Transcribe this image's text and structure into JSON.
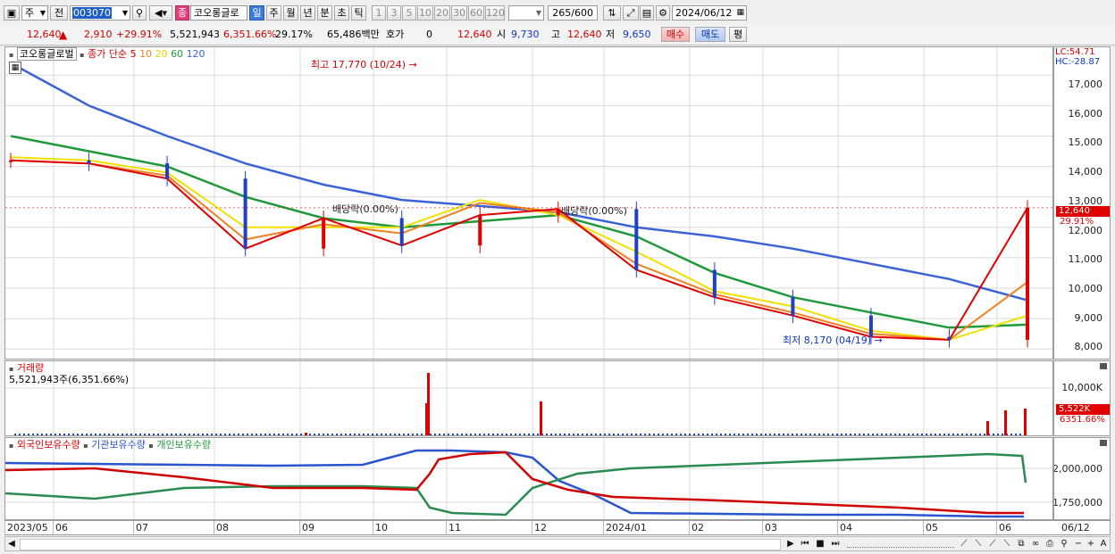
{
  "toolbar": {
    "period_opt": "주",
    "prev_label": "전",
    "code": "003070",
    "name_badge": "종",
    "name": "코오롱글로",
    "periods": [
      "일",
      "주",
      "월",
      "년",
      "분",
      "초",
      "틱"
    ],
    "selected_period": "일",
    "minutes": [
      "1",
      "3",
      "5",
      "10",
      "20",
      "30",
      "60",
      "120"
    ],
    "count": "265",
    "count_max": "/600",
    "date": "2024/06/12"
  },
  "quote": {
    "price": "12,640",
    "change": "2,910",
    "change_pct": "+29.91%",
    "volume": "5,521,943",
    "volume_pct": "6,351.66%",
    "turnover_pct": "29.17%",
    "amount": "65,486백만",
    "hoga_label": "호가",
    "hoga": "0",
    "hoga_price": "12,640",
    "open_label": "시",
    "open": "9,730",
    "high_label": "고",
    "high": "12,640",
    "low_label": "저",
    "low": "9,650",
    "buy_btn": "매수",
    "sell_btn": "매도",
    "eval_btn": "평"
  },
  "price_panel": {
    "legend_name": "코오롱글로벌",
    "legend_ma": "종가 단순",
    "ma_periods": [
      "5",
      "10",
      "20",
      "60",
      "120"
    ],
    "lc": "LC:54.71",
    "hc": "HC:-28.87",
    "hi_annot": "최고 17,770 (10/24)",
    "lo_annot": "최저 8,170 (04/19)",
    "div1": "배당락(0.00%)",
    "div2": "배당락(0.00%)",
    "last_price": "12,640",
    "last_pct": "29.91%",
    "y_ticks": [
      "17,000",
      "16,000",
      "15,000",
      "14,000",
      "13,000",
      "12,000",
      "11,000",
      "10,000",
      "9,000",
      "8,000"
    ]
  },
  "volume_panel": {
    "title": "거래량",
    "value": "5,521,943주(6,351.66%)",
    "y_tick": "10,000K",
    "last": "5,522K",
    "last_pct": "6351.66%"
  },
  "holder_panel": {
    "foreign": "외국인보유수량",
    "inst": "기관보유수량",
    "indiv": "개인보유수량",
    "y_ticks": [
      "2,000,000",
      "1,750,000"
    ]
  },
  "x_axis": [
    "2023/05",
    "06",
    "07",
    "08",
    "09",
    "10",
    "11",
    "12",
    "2024/01",
    "02",
    "03",
    "04",
    "05",
    "06",
    "06/12"
  ],
  "colors": {
    "up": "#e00000",
    "down": "#1f3fc9",
    "ma5": "#e00000",
    "ma10": "#f08020",
    "ma20": "#f2e000",
    "ma60": "#1f9a3a",
    "ma120": "#3b63d8"
  },
  "chart_data": {
    "type": "line",
    "x": [
      "2023/05",
      "2023/06",
      "2023/07",
      "2023/08",
      "2023/09",
      "2023/10",
      "2023/11",
      "2023/12",
      "2024/01",
      "2024/02",
      "2024/03",
      "2024/04",
      "2024/05",
      "2024/06"
    ],
    "series": [
      {
        "name": "5",
        "values": [
          14200,
          14100,
          13600,
          11300,
          12300,
          11400,
          12400,
          12600,
          10600,
          9700,
          9100,
          8400,
          8300,
          12640
        ]
      },
      {
        "name": "10",
        "values": [
          14200,
          14100,
          13700,
          11600,
          12100,
          11800,
          12800,
          12500,
          10800,
          9800,
          9200,
          8500,
          8300,
          10200
        ]
      },
      {
        "name": "20",
        "values": [
          14300,
          14200,
          13800,
          12000,
          12000,
          12000,
          12900,
          12400,
          11200,
          9900,
          9400,
          8600,
          8300,
          9100
        ]
      },
      {
        "name": "60",
        "values": [
          15000,
          14500,
          14000,
          13000,
          12300,
          12000,
          12200,
          12400,
          11700,
          10500,
          9700,
          9200,
          8700,
          8800
        ]
      },
      {
        "name": "120",
        "values": [
          17400,
          16000,
          15000,
          14100,
          13400,
          12900,
          12700,
          12500,
          12000,
          11700,
          11300,
          10800,
          10300,
          9600
        ]
      }
    ],
    "ylim": [
      7800,
      17800
    ]
  }
}
